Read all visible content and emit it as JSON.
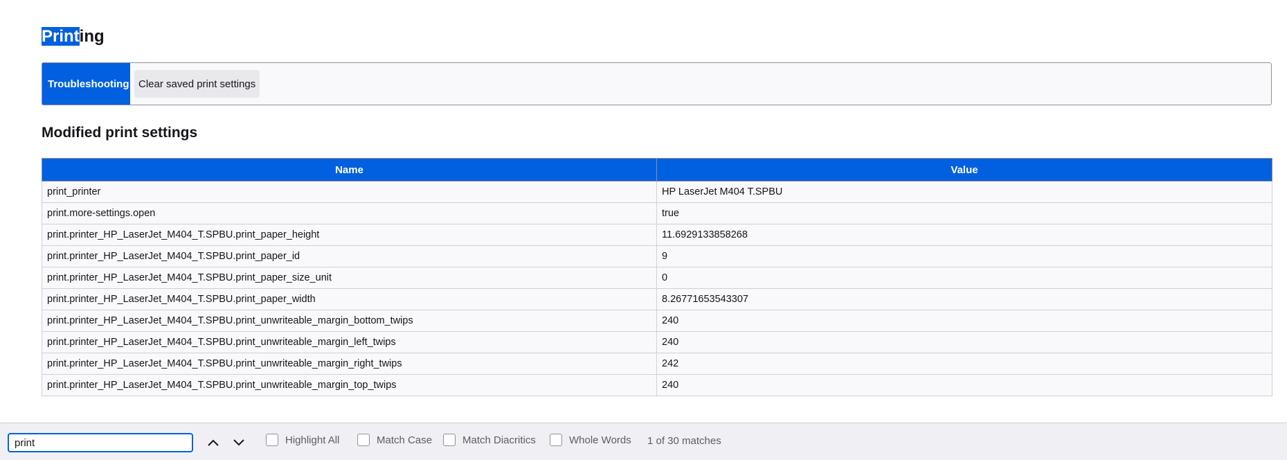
{
  "page": {
    "title_highlighted": "Print",
    "title_rest": "ing",
    "toolbox": {
      "troubleshooting_label": "Troubleshooting",
      "clear_label": "Clear saved print settings"
    },
    "section_title": "Modified print settings",
    "table": {
      "headers": [
        "Name",
        "Value"
      ],
      "rows": [
        [
          "print_printer",
          "HP LaserJet M404 T.SPBU"
        ],
        [
          "print.more-settings.open",
          "true"
        ],
        [
          "print.printer_HP_LaserJet_M404_T.SPBU.print_paper_height",
          "11.6929133858268"
        ],
        [
          "print.printer_HP_LaserJet_M404_T.SPBU.print_paper_id",
          "9"
        ],
        [
          "print.printer_HP_LaserJet_M404_T.SPBU.print_paper_size_unit",
          "0"
        ],
        [
          "print.printer_HP_LaserJet_M404_T.SPBU.print_paper_width",
          "8.26771653543307"
        ],
        [
          "print.printer_HP_LaserJet_M404_T.SPBU.print_unwriteable_margin_bottom_twips",
          "240"
        ],
        [
          "print.printer_HP_LaserJet_M404_T.SPBU.print_unwriteable_margin_left_twips",
          "240"
        ],
        [
          "print.printer_HP_LaserJet_M404_T.SPBU.print_unwriteable_margin_right_twips",
          "242"
        ],
        [
          "print.printer_HP_LaserJet_M404_T.SPBU.print_unwriteable_margin_top_twips",
          "240"
        ]
      ]
    }
  },
  "findbar": {
    "query": "print",
    "highlight_all": "Highlight All",
    "match_case": "Match Case",
    "match_diacritics": "Match Diacritics",
    "whole_words": "Whole Words",
    "status": "1 of 30 matches"
  },
  "colors": {
    "accent": "#0060df",
    "table_cell_bg": "#f9f9fb",
    "findbar_bg": "#f0f0f4"
  }
}
